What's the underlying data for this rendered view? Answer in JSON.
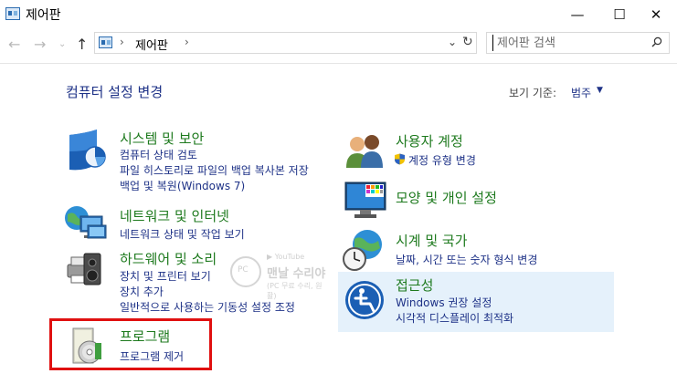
{
  "window": {
    "title": "제어판",
    "minimize": "—",
    "maximize": "☐",
    "close": "✕"
  },
  "nav": {
    "back": "←",
    "forward": "→",
    "recent": "⌄",
    "up": "↑"
  },
  "address": {
    "separator_start": "›",
    "path": "제어판",
    "separator_end": "›",
    "dropdown": "⌄",
    "refresh": "↻"
  },
  "search": {
    "placeholder": "제어판 검색"
  },
  "main": {
    "title": "컴퓨터 설정 변경",
    "view_by_label": "보기 기준:",
    "view_by_value": "범주",
    "view_by_arrow": "▼"
  },
  "categories": {
    "security": {
      "title": "시스템 및 보안",
      "links": [
        "컴퓨터 상태 검토",
        "파일 히스토리로 파일의 백업 복사본 저장",
        "백업 및 복원(Windows 7)"
      ]
    },
    "network": {
      "title": "네트워크 및 인터넷",
      "links": [
        "네트워크 상태 및 작업 보기"
      ]
    },
    "hardware": {
      "title": "하드웨어 및 소리",
      "links": [
        "장치 및 프린터 보기",
        "장치 추가",
        "일반적으로 사용하는 기동성 설정 조정"
      ]
    },
    "programs": {
      "title": "프로그램",
      "links": [
        "프로그램 제거"
      ]
    },
    "accounts": {
      "title": "사용자 계정",
      "links": [
        "계정 유형 변경"
      ]
    },
    "appearance": {
      "title": "모양 및 개인 설정",
      "links": []
    },
    "clock": {
      "title": "시계 및 국가",
      "links": [
        "날짜, 시간 또는 숫자 형식 변경"
      ]
    },
    "access": {
      "title": "접근성",
      "links": [
        "Windows 권장 설정",
        "시각적 디스플레이 최적화"
      ]
    }
  },
  "watermark": {
    "line1": "▶ YouTube",
    "line2": "맨날 수리야",
    "line3": "(PC 무료 수리, 원활)",
    "badge": "PC"
  },
  "colors": {
    "category_title": "#1e7a1e",
    "link": "#1e3287",
    "highlight_border": "#e01010",
    "hover_bg": "#e5f1fb"
  }
}
